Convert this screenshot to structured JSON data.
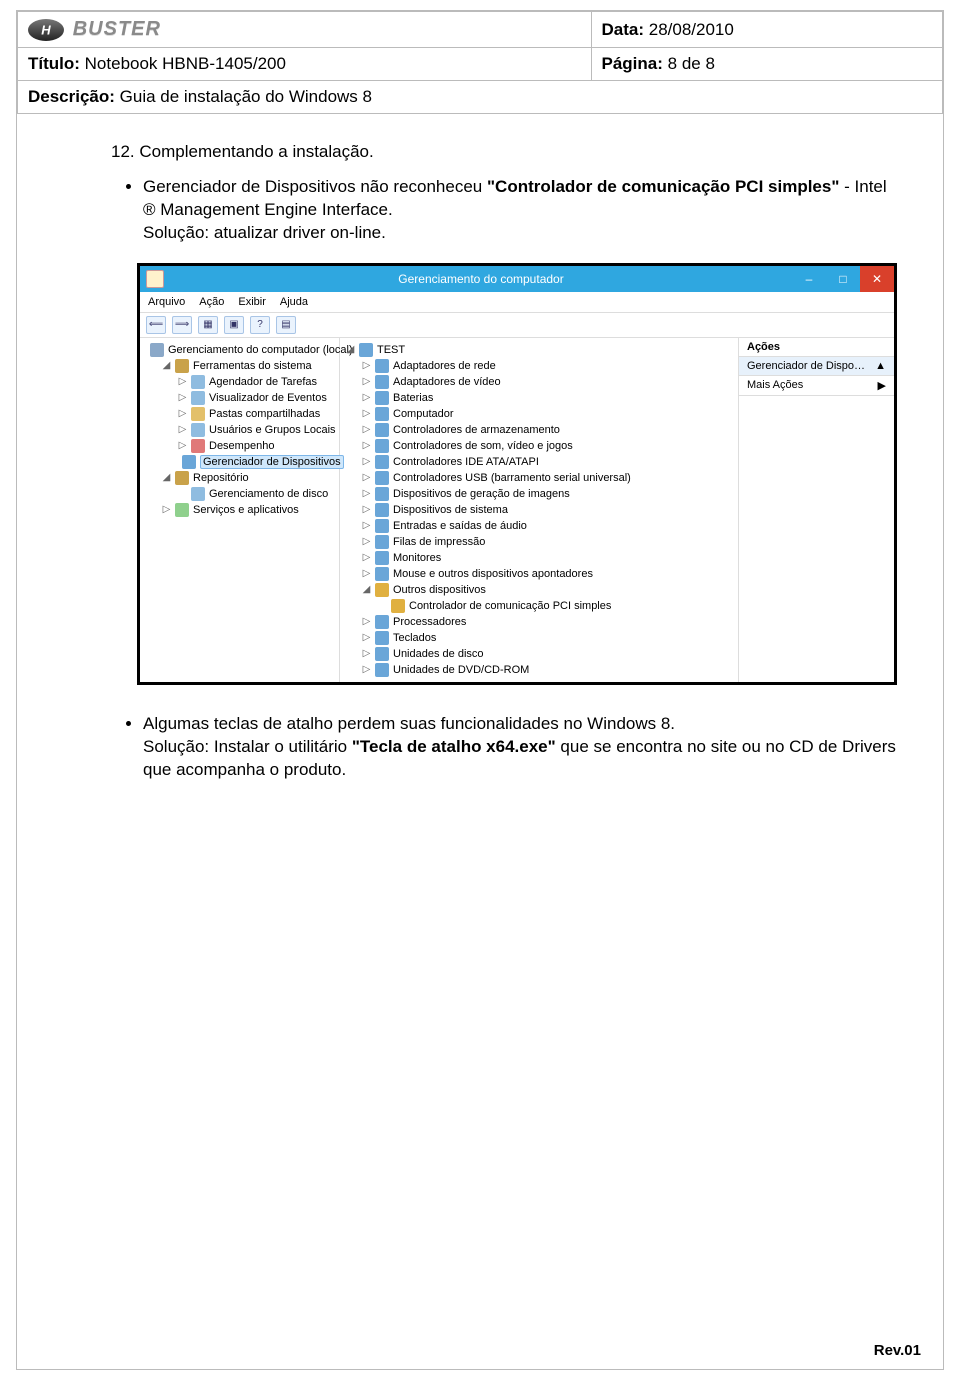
{
  "header": {
    "data_label": "Data:",
    "data_value": "28/08/2010",
    "titulo_label": "Título:",
    "titulo_value": "Notebook HBNB-1405/200",
    "pagina_label": "Página:",
    "pagina_value": "8 de 8",
    "descricao_label": "Descrição:",
    "descricao_value": "Guia de instalação do Windows 8",
    "logo_text": "BUSTER"
  },
  "content": {
    "step_number": "12.",
    "step_title": "Complementando a instalação.",
    "bullet1_pre": "Gerenciador de Dispositivos não reconheceu ",
    "bullet1_bold": "\"Controlador de comunicação PCI simples\"",
    "bullet1_post": " - Intel ® Management Engine Interface.",
    "bullet1_sol": "Solução: atualizar driver on-line.",
    "bullet2_a": "Algumas teclas de atalho perdem suas funcionalidades no Windows 8.",
    "bullet2_b_pre": "Solução: Instalar o utilitário ",
    "bullet2_b_bold": "\"Tecla de atalho x64.exe\"",
    "bullet2_b_post": " que se encontra no site ou no CD de Drivers que acompanha o produto."
  },
  "window": {
    "title": "Gerenciamento do computador",
    "min": "–",
    "max": "□",
    "close": "✕",
    "menu": [
      "Arquivo",
      "Ação",
      "Exibir",
      "Ajuda"
    ],
    "toolbar": [
      "⟸",
      "⟹",
      "▦",
      "▣",
      "?",
      "▤"
    ],
    "actions_header": "Ações",
    "actions_row": "Gerenciador de Dispo…",
    "actions_caret": "▲",
    "actions_more": "Mais Ações",
    "actions_more_caret": "▶",
    "left_tree": [
      {
        "lvl": 1,
        "exp": "",
        "icon": "#8aa8c8",
        "text": "Gerenciamento do computador (local)"
      },
      {
        "lvl": 2,
        "exp": "◢",
        "icon": "#c9a24a",
        "text": "Ferramentas do sistema"
      },
      {
        "lvl": 3,
        "exp": "▷",
        "icon": "#8fbce0",
        "text": "Agendador de Tarefas"
      },
      {
        "lvl": 3,
        "exp": "▷",
        "icon": "#8fbce0",
        "text": "Visualizador de Eventos"
      },
      {
        "lvl": 3,
        "exp": "▷",
        "icon": "#e3c06a",
        "text": "Pastas compartilhadas"
      },
      {
        "lvl": 3,
        "exp": "▷",
        "icon": "#8fbce0",
        "text": "Usuários e Grupos Locais"
      },
      {
        "lvl": 3,
        "exp": "▷",
        "icon": "#e07979",
        "text": "Desempenho"
      },
      {
        "lvl": 3,
        "exp": "",
        "icon": "#6aa6d8",
        "text": "Gerenciador de Dispositivos",
        "selected": true
      },
      {
        "lvl": 2,
        "exp": "◢",
        "icon": "#c9a24a",
        "text": "Repositório"
      },
      {
        "lvl": 3,
        "exp": "",
        "icon": "#8fbce0",
        "text": "Gerenciamento de disco"
      },
      {
        "lvl": 2,
        "exp": "▷",
        "icon": "#8fd08d",
        "text": "Serviços e aplicativos"
      }
    ],
    "mid_tree": [
      {
        "lvl": 1,
        "exp": "◢",
        "icon": "#6aa6d8",
        "text": "TEST"
      },
      {
        "lvl": 2,
        "exp": "▷",
        "icon": "#6aa6d8",
        "text": "Adaptadores de rede"
      },
      {
        "lvl": 2,
        "exp": "▷",
        "icon": "#6aa6d8",
        "text": "Adaptadores de vídeo"
      },
      {
        "lvl": 2,
        "exp": "▷",
        "icon": "#6aa6d8",
        "text": "Baterias"
      },
      {
        "lvl": 2,
        "exp": "▷",
        "icon": "#6aa6d8",
        "text": "Computador"
      },
      {
        "lvl": 2,
        "exp": "▷",
        "icon": "#6aa6d8",
        "text": "Controladores de armazenamento"
      },
      {
        "lvl": 2,
        "exp": "▷",
        "icon": "#6aa6d8",
        "text": "Controladores de som, vídeo e jogos"
      },
      {
        "lvl": 2,
        "exp": "▷",
        "icon": "#6aa6d8",
        "text": "Controladores IDE ATA/ATAPI"
      },
      {
        "lvl": 2,
        "exp": "▷",
        "icon": "#6aa6d8",
        "text": "Controladores USB (barramento serial universal)"
      },
      {
        "lvl": 2,
        "exp": "▷",
        "icon": "#6aa6d8",
        "text": "Dispositivos de geração de imagens"
      },
      {
        "lvl": 2,
        "exp": "▷",
        "icon": "#6aa6d8",
        "text": "Dispositivos de sistema"
      },
      {
        "lvl": 2,
        "exp": "▷",
        "icon": "#6aa6d8",
        "text": "Entradas e saídas de áudio"
      },
      {
        "lvl": 2,
        "exp": "▷",
        "icon": "#6aa6d8",
        "text": "Filas de impressão"
      },
      {
        "lvl": 2,
        "exp": "▷",
        "icon": "#6aa6d8",
        "text": "Monitores"
      },
      {
        "lvl": 2,
        "exp": "▷",
        "icon": "#6aa6d8",
        "text": "Mouse e outros dispositivos apontadores"
      },
      {
        "lvl": 2,
        "exp": "◢",
        "icon": "#e0b040",
        "text": "Outros dispositivos"
      },
      {
        "lvl": 3,
        "exp": "",
        "icon": "#e0b040",
        "text": "Controlador de comunicação PCI simples"
      },
      {
        "lvl": 2,
        "exp": "▷",
        "icon": "#6aa6d8",
        "text": "Processadores"
      },
      {
        "lvl": 2,
        "exp": "▷",
        "icon": "#6aa6d8",
        "text": "Teclados"
      },
      {
        "lvl": 2,
        "exp": "▷",
        "icon": "#6aa6d8",
        "text": "Unidades de disco"
      },
      {
        "lvl": 2,
        "exp": "▷",
        "icon": "#6aa6d8",
        "text": "Unidades de DVD/CD-ROM"
      }
    ]
  },
  "footer": {
    "rev": "Rev.01"
  }
}
